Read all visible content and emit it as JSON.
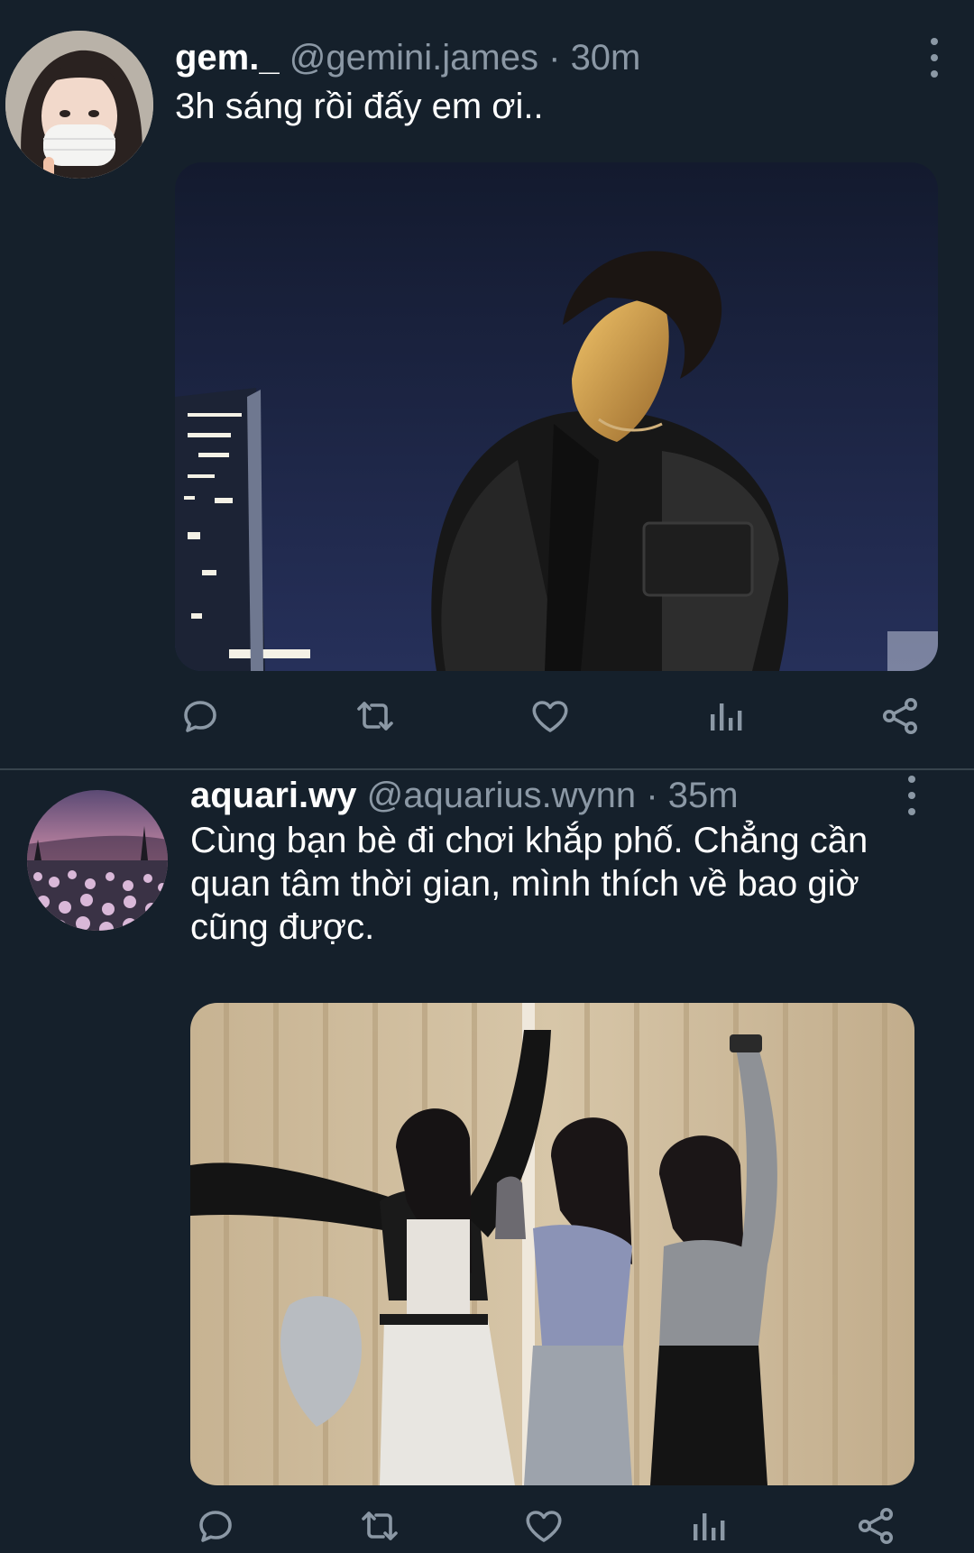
{
  "tweets": [
    {
      "display_name": "gem._",
      "handle": "@gemini.james",
      "separator": "·",
      "time": "30m",
      "text": "3h sáng rồi đấy em ơi..",
      "avatar_icon": "user-avatar",
      "media_desc": "night-city-photo"
    },
    {
      "display_name": "aquari.wy",
      "handle": "@aquarius.wynn",
      "separator": "·",
      "time": "35m",
      "text": "Cùng bạn bè đi chơi khắp phố. Chẳng cần quan tâm thời gian, mình thích về bao giờ cũng được.",
      "avatar_icon": "flower-field-avatar",
      "media_desc": "friends-group-photo"
    }
  ],
  "action_icons": [
    "reply-icon",
    "retweet-icon",
    "like-icon",
    "views-icon",
    "share-icon"
  ],
  "colors": {
    "background": "#15202b",
    "secondary_text": "#8b98a5",
    "divider": "#38444d"
  }
}
